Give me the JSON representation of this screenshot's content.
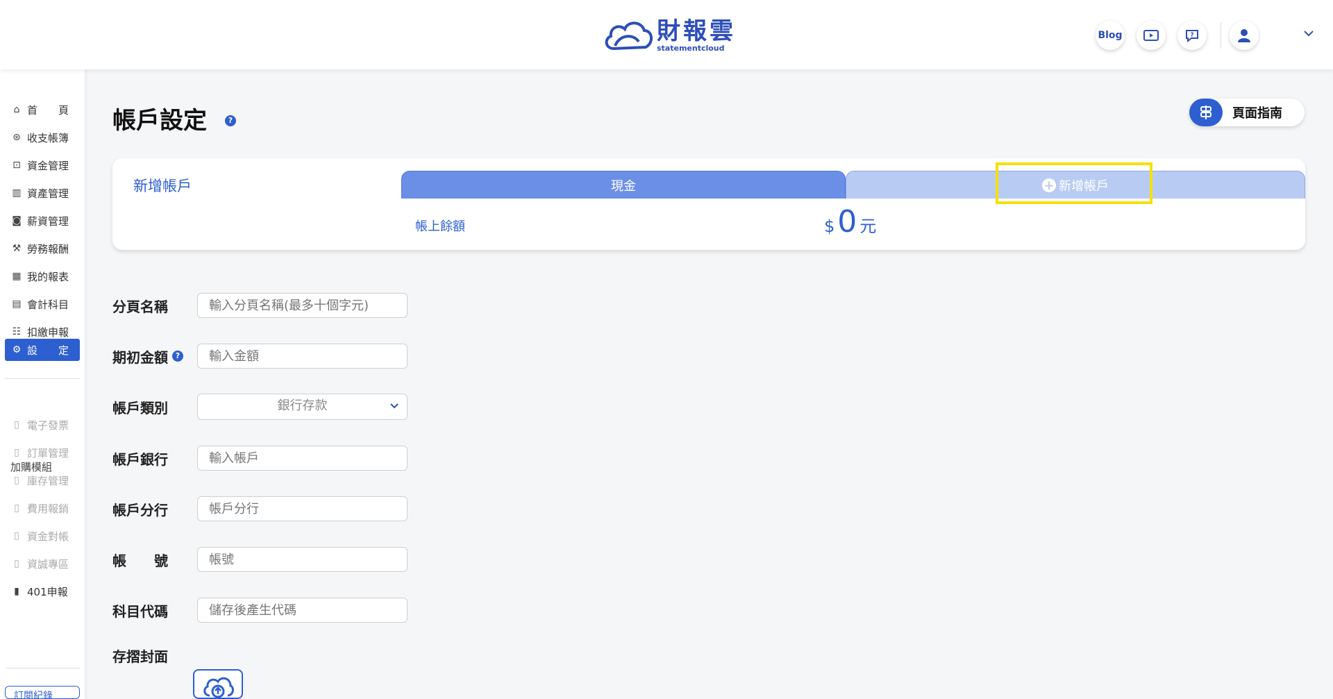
{
  "header": {
    "logo_cn": "財報雲",
    "logo_en": "statementcloud",
    "blog_label": "Blog"
  },
  "sidebar": {
    "items": [
      {
        "label": "首　　頁",
        "icon": "home-icon"
      },
      {
        "label": "收支帳簿",
        "icon": "ledger-icon"
      },
      {
        "label": "資金管理",
        "icon": "funds-icon"
      },
      {
        "label": "資產管理",
        "icon": "assets-icon"
      },
      {
        "label": "薪資管理",
        "icon": "payroll-icon"
      },
      {
        "label": "勞務報酬",
        "icon": "labor-icon"
      },
      {
        "label": "我的報表",
        "icon": "report-icon"
      },
      {
        "label": "會計科目",
        "icon": "accounts-icon"
      },
      {
        "label": "扣繳申報",
        "icon": "withholding-icon"
      },
      {
        "label": "設　　定",
        "icon": "settings-icon"
      }
    ],
    "section_label": "加購模組",
    "addons": [
      {
        "label": "電子發票"
      },
      {
        "label": "訂單管理"
      },
      {
        "label": "庫存管理"
      },
      {
        "label": "費用報銷"
      },
      {
        "label": "資金對帳"
      },
      {
        "label": "資誠專區"
      },
      {
        "label": "401申報"
      }
    ],
    "bottom_button": "訂閱紀錄"
  },
  "main": {
    "title": "帳戶設定",
    "guide_label": "頁面指南",
    "account_card": {
      "new_account_label": "新增帳戶",
      "tabs": [
        {
          "label": "現金"
        },
        {
          "label": "新增帳戶"
        }
      ],
      "balance_label": "帳上餘額",
      "balance_currency": "$",
      "balance_value": "0",
      "balance_unit": "元"
    },
    "form": {
      "page_name": {
        "label": "分頁名稱",
        "placeholder": "輸入分頁名稱(最多十個字元)"
      },
      "initial_amount": {
        "label": "期初金額",
        "placeholder": "輸入金額"
      },
      "account_type": {
        "label": "帳戶類別",
        "value": "銀行存款"
      },
      "bank": {
        "label": "帳戶銀行",
        "placeholder": "輸入帳戶"
      },
      "branch": {
        "label": "帳戶分行",
        "placeholder": "帳戶分行"
      },
      "account_no": {
        "label": "帳　　號",
        "placeholder": "帳號"
      },
      "subject_code": {
        "label": "科目代碼",
        "placeholder": "儲存後產生代碼"
      },
      "passbook_cover": {
        "label": "存摺封面"
      }
    }
  },
  "colors": {
    "brand": "#2d5fd0",
    "tab_active": "#6b8fe6",
    "tab_inactive": "#b8cbf3",
    "highlight": "#f5e10c"
  }
}
